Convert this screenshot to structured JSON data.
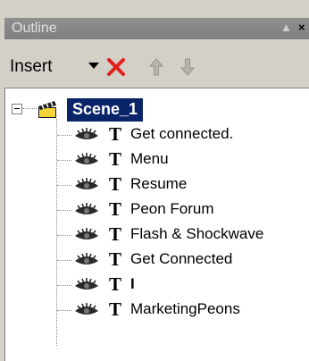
{
  "panel": {
    "title": "Outline",
    "minimize_glyph": "▲",
    "close_glyph": "×"
  },
  "toolbar": {
    "insert_label": "Insert",
    "icons": [
      "caret-down-icon",
      "delete-x-icon",
      "move-up-icon",
      "move-down-icon"
    ]
  },
  "tree": {
    "root": {
      "label": "Scene_1",
      "icon": "scene-clapperboard-icon",
      "expander": "minus"
    },
    "items": [
      {
        "label": "Get connected.",
        "type_glyph": "T"
      },
      {
        "label": "Menu",
        "type_glyph": "T"
      },
      {
        "label": "Resume",
        "type_glyph": "T"
      },
      {
        "label": "Peon Forum",
        "type_glyph": "T"
      },
      {
        "label": "Flash & Shockwave",
        "type_glyph": "T"
      },
      {
        "label": "Get Connected",
        "type_glyph": "T"
      },
      {
        "label": "I",
        "type_glyph": "T"
      },
      {
        "label": "MarketingPeons",
        "type_glyph": "T"
      }
    ]
  },
  "colors": {
    "selection": "#0a246a",
    "titlebar": "#808080",
    "delete_red": "#e0201c"
  }
}
